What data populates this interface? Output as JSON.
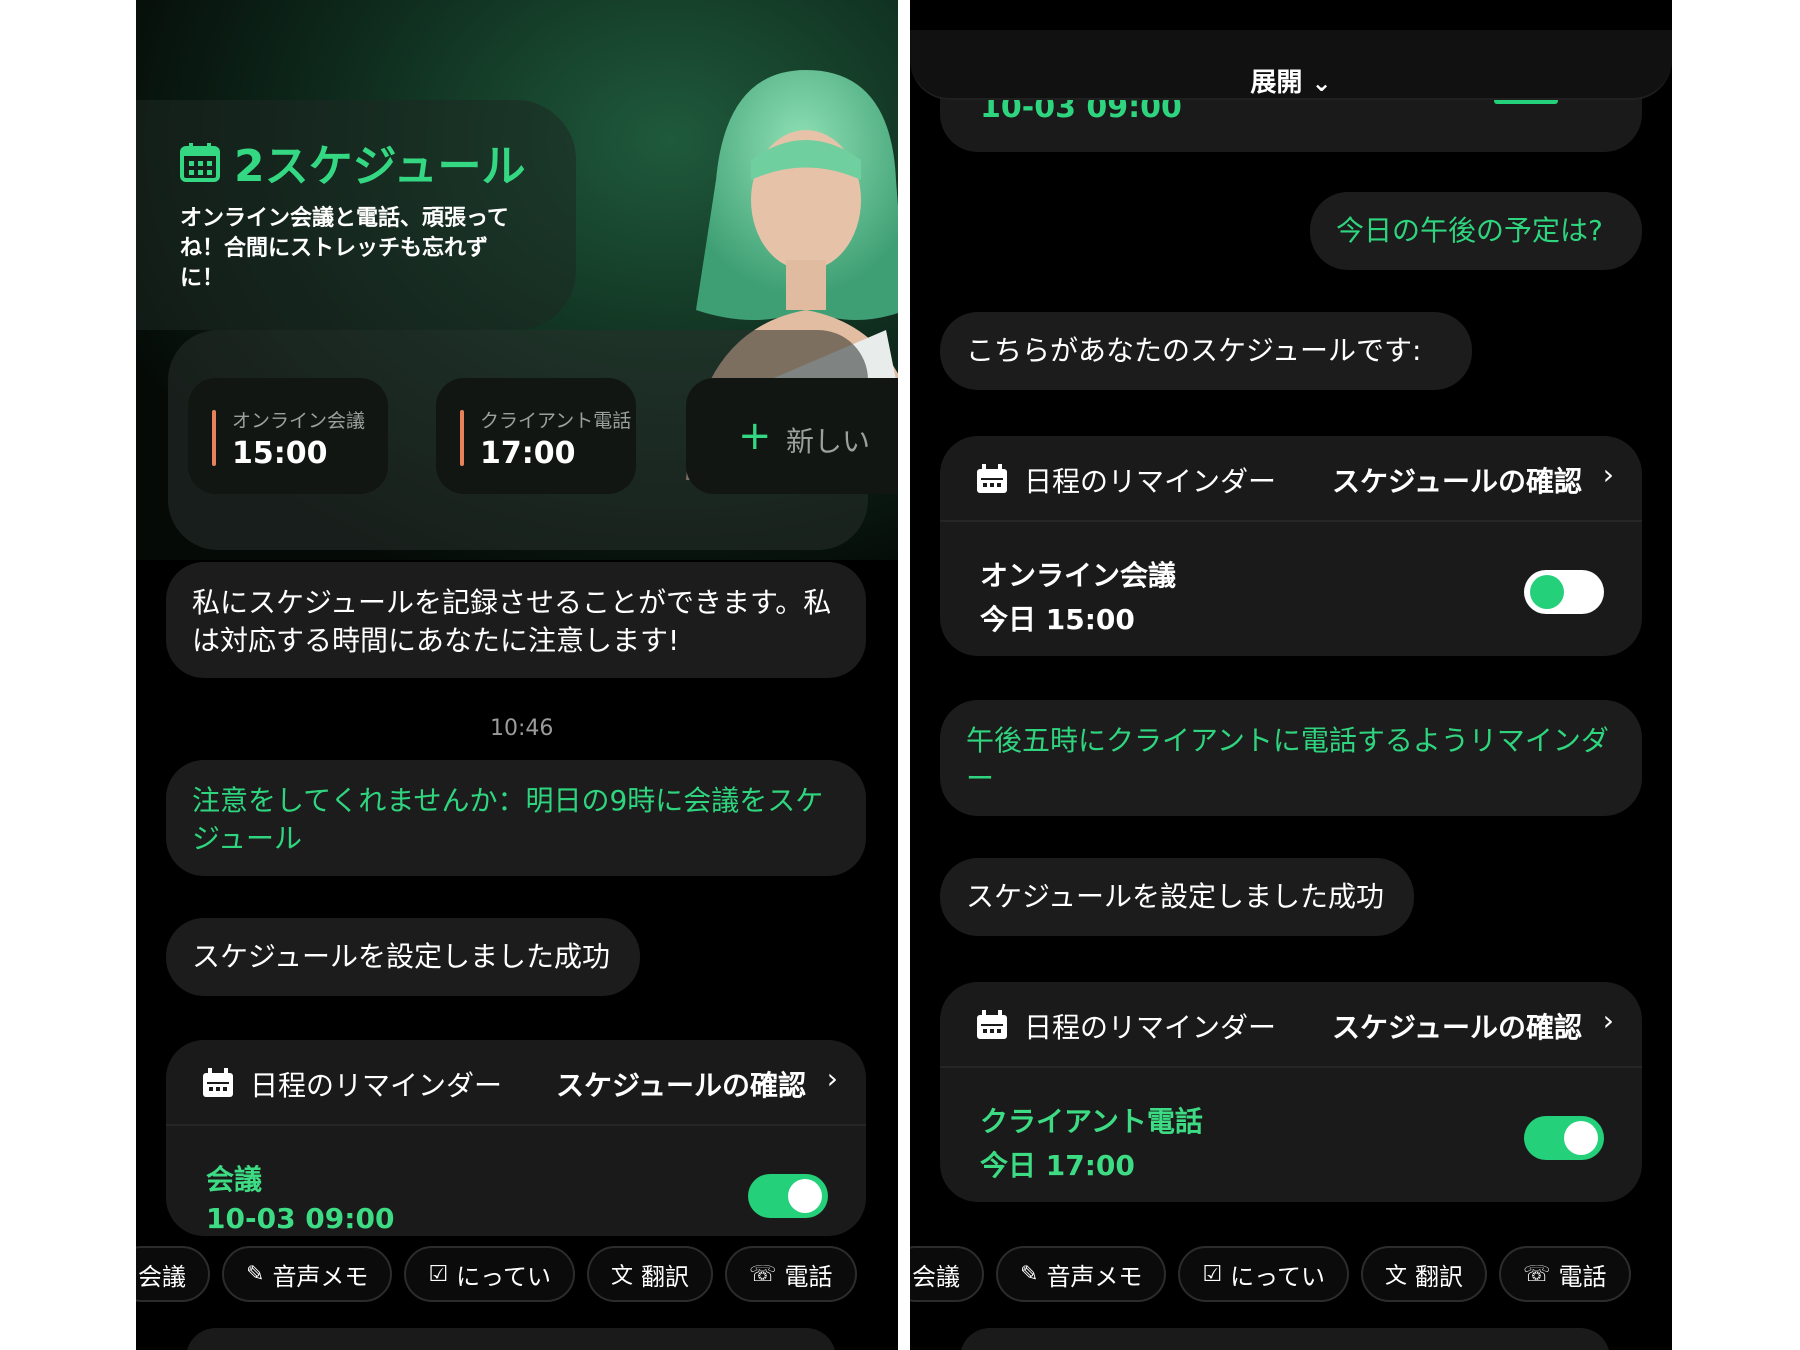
{
  "left": {
    "hero": {
      "title": "2スケジュール",
      "subtitle": "オンライン会議と電話、頑張ってね！合間にストレッチも忘れずに！",
      "cards": [
        {
          "label": "オンライン会議",
          "time": "15:00"
        },
        {
          "label": "クライアント電話",
          "time": "17:00"
        }
      ],
      "new_card_label": "新しい"
    },
    "intro_message": "私にスケジュールを記録させることができます。私は対応する時間にあなたに注意します!",
    "timestamp": "10:46",
    "user_message": "注意をしてくれませんか：明日の9時に会議をスケジュール",
    "bot_message": "スケジュールを設定しました成功",
    "reminder": {
      "title": "日程のリマインダー",
      "link": "スケジュールの確認",
      "name": "会議",
      "time": "10-03 09:00",
      "enabled": true
    },
    "chips": [
      "会議",
      "音声メモ",
      "にってい",
      "翻訳",
      "電話"
    ]
  },
  "right": {
    "expand_label": "展開",
    "top_card_time": "10-03 09:00",
    "user_message_1": "今日の午後の予定は?",
    "bot_message_1": "こちらがあなたのスケジュールです:",
    "reminder_1": {
      "title": "日程のリマインダー",
      "link": "スケジュールの確認",
      "name": "オンライン会議",
      "time": "今日 15:00",
      "enabled": false
    },
    "user_message_2": "午後五時にクライアントに電話するようリマインダー",
    "bot_message_2": "スケジュールを設定しました成功",
    "reminder_2": {
      "title": "日程のリマインダー",
      "link": "スケジュールの確認",
      "name": "クライアント電話",
      "time": "今日 17:00",
      "enabled": true
    },
    "chips": [
      "会議",
      "音声メモ",
      "にってい",
      "翻訳",
      "電話"
    ]
  },
  "colors": {
    "accent_green": "#2fd57e",
    "background": "#000000",
    "bubble": "#1c1c1c",
    "card_bar": "#e8825a"
  }
}
